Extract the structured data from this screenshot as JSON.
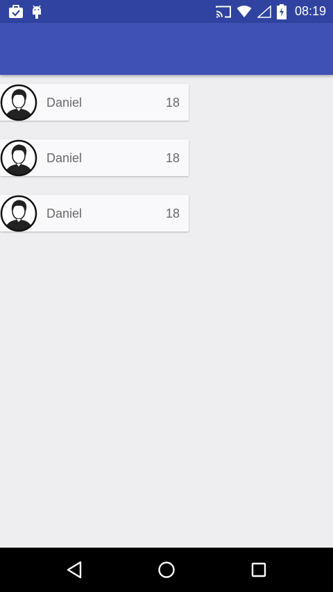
{
  "status_bar": {
    "time": "08:19",
    "icons": [
      "briefcase-check-icon",
      "android-debug-icon",
      "cast-icon",
      "wifi-icon",
      "signal-icon",
      "battery-charging-icon"
    ]
  },
  "app_bar": {
    "color": "#3f51b5",
    "status_color": "#3043a0"
  },
  "list": {
    "items": [
      {
        "name": "Daniel",
        "age": "18",
        "avatar": "person-avatar-icon"
      },
      {
        "name": "Daniel",
        "age": "18",
        "avatar": "person-avatar-icon"
      },
      {
        "name": "Daniel",
        "age": "18",
        "avatar": "person-avatar-icon"
      }
    ]
  },
  "nav_bar": {
    "buttons": [
      "back-icon",
      "home-icon",
      "recents-icon"
    ]
  }
}
